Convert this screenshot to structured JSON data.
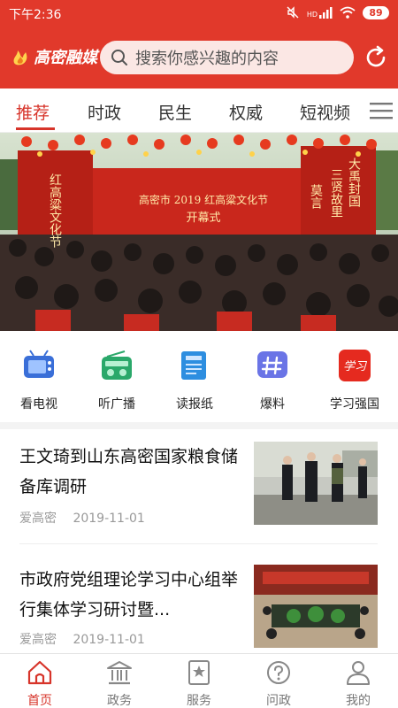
{
  "status_bar": {
    "time": "下午2:36",
    "signal_label": "HD",
    "battery": "89"
  },
  "header": {
    "logo_text": "高密融媒",
    "search_placeholder": "搜索你感兴趣的内容"
  },
  "tabs": [
    {
      "label": "推荐",
      "active": true
    },
    {
      "label": "时政"
    },
    {
      "label": "民生"
    },
    {
      "label": "权威"
    },
    {
      "label": "短视频"
    }
  ],
  "banner": {
    "stage_title": "高密市 2019 红高粱文化节",
    "stage_sub": "开幕式",
    "left_banner": "红高粱文化节",
    "right_banner_1": "大禹封国",
    "right_banner_2": "三贤故里",
    "right_banner_3": "莫言"
  },
  "quick_links": [
    {
      "label": "看电视",
      "icon": "tv-icon"
    },
    {
      "label": "听广播",
      "icon": "radio-icon"
    },
    {
      "label": "读报纸",
      "icon": "newspaper-icon"
    },
    {
      "label": "爆料",
      "icon": "hashtag-icon"
    },
    {
      "label": "学习强国",
      "icon": "xuexi-logo-icon",
      "logo_text": "学习"
    }
  ],
  "news": [
    {
      "title": "王文琦到山东高密国家粮食储备库调研",
      "source": "爱高密",
      "date": "2019-11-01"
    },
    {
      "title": "市政府党组理论学习中心组举行集体学习研讨暨...",
      "source": "爱高密",
      "date": "2019-11-01"
    }
  ],
  "bottom_nav": [
    {
      "label": "首页",
      "icon": "home-icon",
      "active": true
    },
    {
      "label": "政务",
      "icon": "government-building-icon"
    },
    {
      "label": "服务",
      "icon": "bookmark-star-icon"
    },
    {
      "label": "问政",
      "icon": "question-icon"
    },
    {
      "label": "我的",
      "icon": "user-icon"
    }
  ],
  "colors": {
    "brand_red": "#e1392b",
    "active_tab": "#d7342a",
    "tv_blue": "#3a6fd8",
    "radio_green": "#2aa86a",
    "paper_blue": "#2d8ee0",
    "hashtag_purple": "#6a74e6",
    "xuexi_red": "#e52a1f"
  }
}
